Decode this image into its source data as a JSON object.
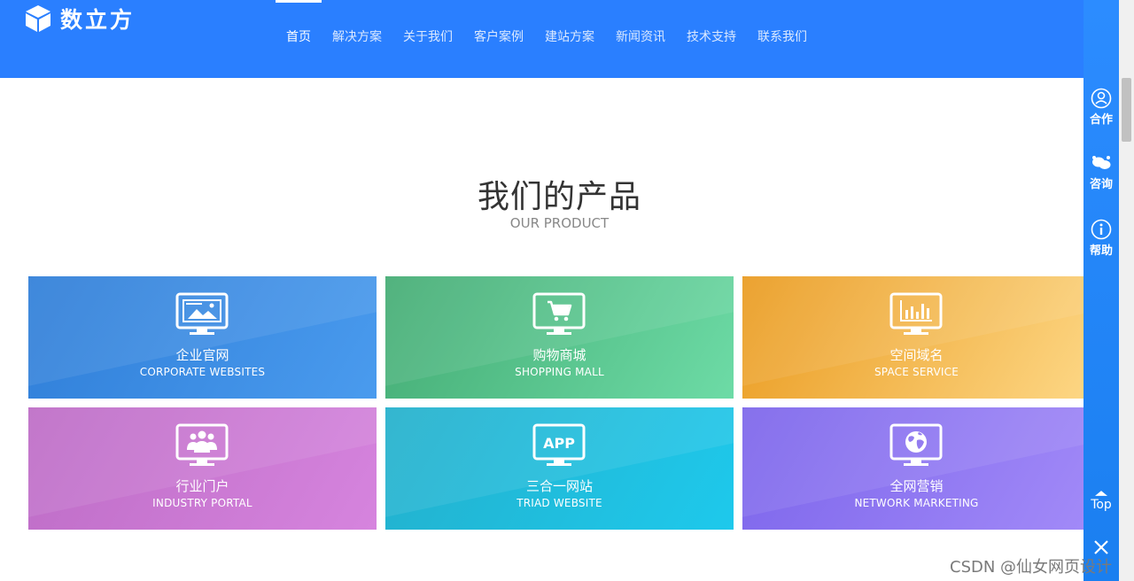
{
  "header": {
    "logo_text": "数立方",
    "nav": [
      "首页",
      "解决方案",
      "关于我们",
      "客户案例",
      "建站方案",
      "新闻资讯",
      "技术支持",
      "联系我们"
    ],
    "active_index": 0
  },
  "section": {
    "title": "我们的产品",
    "subtitle": "OUR PRODUCT"
  },
  "products": [
    {
      "cn": "企业官网",
      "en": "CORPORATE WEBSITES",
      "icon": "monitor-image-icon"
    },
    {
      "cn": "购物商城",
      "en": "SHOPPING MALL",
      "icon": "monitor-cart-icon"
    },
    {
      "cn": "空间域名",
      "en": "SPACE SERVICE",
      "icon": "monitor-chart-icon"
    },
    {
      "cn": "行业门户",
      "en": "INDUSTRY PORTAL",
      "icon": "monitor-users-icon"
    },
    {
      "cn": "三合一网站",
      "en": "TRIAD WEBSITE",
      "icon": "monitor-app-icon"
    },
    {
      "cn": "全网营销",
      "en": "NETWORK MARKETING",
      "icon": "monitor-globe-icon"
    }
  ],
  "app_icon_text": "APP",
  "sidebar": {
    "items": [
      "合作",
      "咨询",
      "帮助"
    ],
    "top_label": "Top"
  },
  "watermark": "CSDN @仙女网页设计",
  "colors": {
    "header_bg": "#2a7fff",
    "sidebar_bg": "#2c8cff"
  }
}
